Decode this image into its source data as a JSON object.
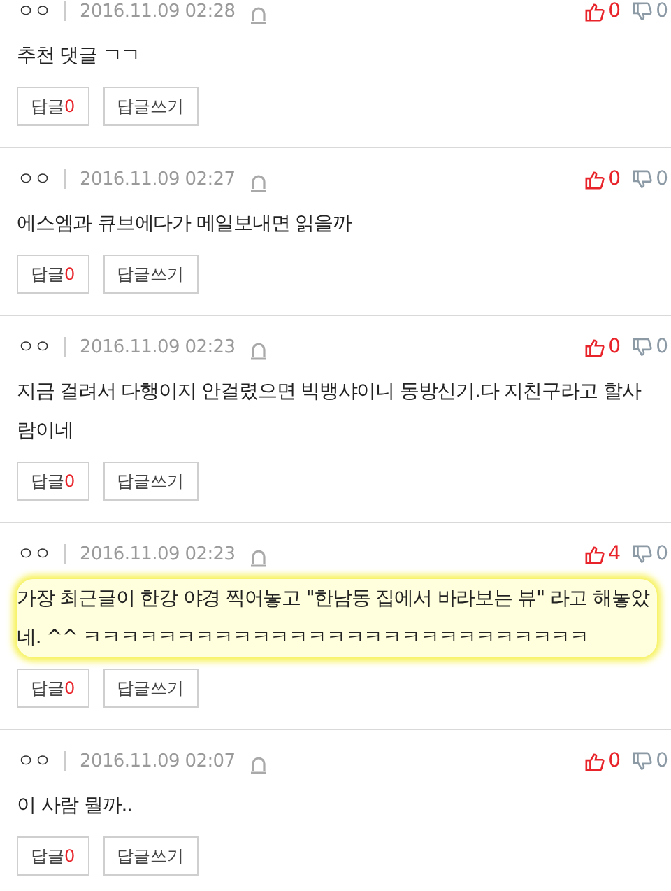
{
  "comments": [
    {
      "author": "ㅇㅇ",
      "date": "2016.11.09 02:28",
      "likes": "0",
      "dislikes": "0",
      "text": "추천 댓글 ㄱㄱ",
      "highlighted": false,
      "reply_label": "답글",
      "reply_count": "0",
      "write_reply": "답글쓰기"
    },
    {
      "author": "ㅇㅇ",
      "date": "2016.11.09 02:27",
      "likes": "0",
      "dislikes": "0",
      "text": "에스엠과 큐브에다가 메일보내면 읽을까",
      "highlighted": false,
      "reply_label": "답글",
      "reply_count": "0",
      "write_reply": "답글쓰기"
    },
    {
      "author": "ㅇㅇ",
      "date": "2016.11.09 02:23",
      "likes": "0",
      "dislikes": "0",
      "text": "지금 걸려서 다행이지 안걸렸으면 빅뱅샤이니 동방신기.다 지친구라고 할사람이네",
      "highlighted": false,
      "reply_label": "답글",
      "reply_count": "0",
      "write_reply": "답글쓰기"
    },
    {
      "author": "ㅇㅇ",
      "date": "2016.11.09 02:23",
      "likes": "4",
      "dislikes": "0",
      "text": "가장 최근글이 한강 야경 찍어놓고 \"한남동 집에서 바라보는 뷰\" 라고 해놓았네. ^^ ㅋㅋㅋㅋㅋㅋㅋㅋㅋㅋㅋㅋㅋㅋㅋㅋㅋㅋㅋㅋㅋㅋㅋㅋㅋㅋㅋ",
      "highlighted": true,
      "reply_label": "답글",
      "reply_count": "0",
      "write_reply": "답글쓰기"
    },
    {
      "author": "ㅇㅇ",
      "date": "2016.11.09 02:07",
      "likes": "0",
      "dislikes": "0",
      "text": "이 사람 뭘까..",
      "highlighted": false,
      "reply_label": "답글",
      "reply_count": "0",
      "write_reply": "답글쓰기"
    }
  ]
}
